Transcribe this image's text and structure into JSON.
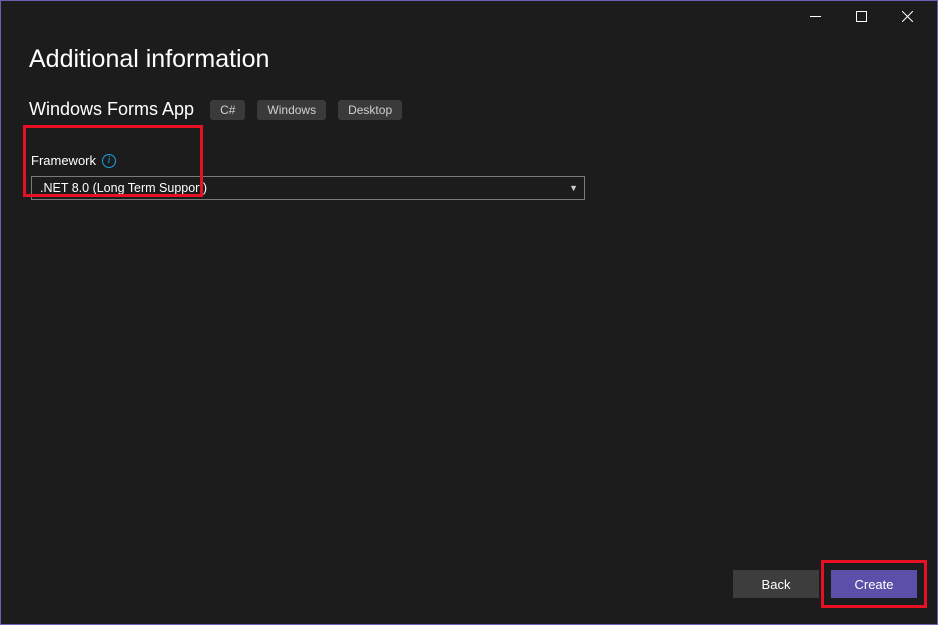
{
  "window": {
    "heading": "Additional information"
  },
  "subtitle": {
    "text": "Windows Forms App",
    "tags": [
      "C#",
      "Windows",
      "Desktop"
    ]
  },
  "framework": {
    "label": "Framework",
    "selected": ".NET 8.0 (Long Term Support)"
  },
  "buttons": {
    "back": "Back",
    "create": "Create"
  }
}
